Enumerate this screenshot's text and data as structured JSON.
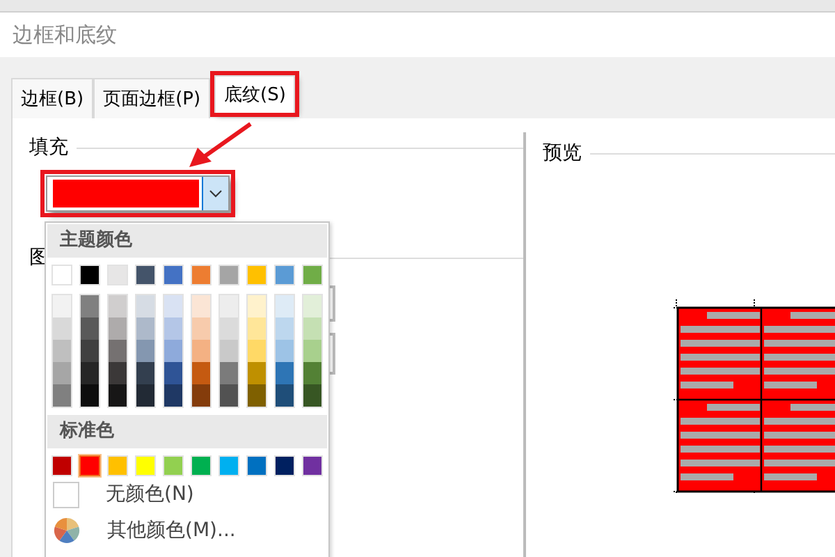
{
  "window": {
    "title": "边框和底纹"
  },
  "tabs": [
    {
      "label": "边框(B)",
      "selected": false
    },
    {
      "label": "页面边框(P)",
      "selected": false
    },
    {
      "label": "底纹(S)",
      "selected": true
    }
  ],
  "fill": {
    "label": "填充"
  },
  "pattern": {
    "label": "图"
  },
  "preview": {
    "label": "预览"
  },
  "color_menu": {
    "theme_heading": "主题颜色",
    "theme_colors": [
      {
        "color": "#ffffff",
        "selected": false,
        "shades": [
          {
            "color": "#f2f2f2",
            "selected": false
          },
          {
            "color": "#d9d9d9",
            "selected": false
          },
          {
            "color": "#bfbfbf",
            "selected": false
          },
          {
            "color": "#a6a6a6",
            "selected": false
          },
          {
            "color": "#808080",
            "selected": false
          }
        ]
      },
      {
        "color": "#000000",
        "selected": false,
        "shades": [
          {
            "color": "#808080",
            "selected": false
          },
          {
            "color": "#595959",
            "selected": false
          },
          {
            "color": "#404040",
            "selected": false
          },
          {
            "color": "#262626",
            "selected": false
          },
          {
            "color": "#0d0d0d",
            "selected": false
          }
        ]
      },
      {
        "color": "#e7e6e6",
        "selected": false,
        "shades": [
          {
            "color": "#d0cece",
            "selected": false
          },
          {
            "color": "#aeabab",
            "selected": false
          },
          {
            "color": "#757171",
            "selected": false
          },
          {
            "color": "#3b3838",
            "selected": false
          },
          {
            "color": "#171616",
            "selected": false
          }
        ]
      },
      {
        "color": "#44546a",
        "selected": false,
        "shades": [
          {
            "color": "#d6dce4",
            "selected": false
          },
          {
            "color": "#adb9ca",
            "selected": false
          },
          {
            "color": "#8497b0",
            "selected": false
          },
          {
            "color": "#333f4f",
            "selected": false
          },
          {
            "color": "#222a35",
            "selected": false
          }
        ]
      },
      {
        "color": "#4472c4",
        "selected": false,
        "shades": [
          {
            "color": "#d9e2f3",
            "selected": false
          },
          {
            "color": "#b4c6e7",
            "selected": false
          },
          {
            "color": "#8eaadb",
            "selected": false
          },
          {
            "color": "#2f5496",
            "selected": false
          },
          {
            "color": "#1f3864",
            "selected": false
          }
        ]
      },
      {
        "color": "#ed7d31",
        "selected": false,
        "shades": [
          {
            "color": "#fbe5d5",
            "selected": false
          },
          {
            "color": "#f7cbac",
            "selected": false
          },
          {
            "color": "#f4b183",
            "selected": false
          },
          {
            "color": "#c55a11",
            "selected": false
          },
          {
            "color": "#843c0b",
            "selected": false
          }
        ]
      },
      {
        "color": "#a5a5a5",
        "selected": false,
        "shades": [
          {
            "color": "#ededed",
            "selected": false
          },
          {
            "color": "#dbdbdb",
            "selected": false
          },
          {
            "color": "#c9c9c9",
            "selected": false
          },
          {
            "color": "#7b7b7b",
            "selected": false
          },
          {
            "color": "#525252",
            "selected": false
          }
        ]
      },
      {
        "color": "#ffc000",
        "selected": false,
        "shades": [
          {
            "color": "#fff2cc",
            "selected": false
          },
          {
            "color": "#ffe699",
            "selected": false
          },
          {
            "color": "#ffd966",
            "selected": false
          },
          {
            "color": "#bf9000",
            "selected": false
          },
          {
            "color": "#7f6000",
            "selected": false
          }
        ]
      },
      {
        "color": "#5b9bd5",
        "selected": false,
        "shades": [
          {
            "color": "#deebf6",
            "selected": false
          },
          {
            "color": "#bdd7ee",
            "selected": false
          },
          {
            "color": "#9dc3e6",
            "selected": false
          },
          {
            "color": "#2e75b5",
            "selected": false
          },
          {
            "color": "#1f4e79",
            "selected": false
          }
        ]
      },
      {
        "color": "#70ad47",
        "selected": false,
        "shades": [
          {
            "color": "#e2efd9",
            "selected": false
          },
          {
            "color": "#c5e0b3",
            "selected": false
          },
          {
            "color": "#a8d08d",
            "selected": false
          },
          {
            "color": "#538135",
            "selected": false
          },
          {
            "color": "#375623",
            "selected": false
          }
        ]
      }
    ],
    "standard_heading": "标准色",
    "standard_colors": [
      {
        "color": "#c00000",
        "selected": false
      },
      {
        "color": "#ff0000",
        "selected": true
      },
      {
        "color": "#ffc000",
        "selected": false
      },
      {
        "color": "#ffff00",
        "selected": false
      },
      {
        "color": "#92d050",
        "selected": false
      },
      {
        "color": "#00b050",
        "selected": false
      },
      {
        "color": "#00b0f0",
        "selected": false
      },
      {
        "color": "#0070c0",
        "selected": false
      },
      {
        "color": "#002060",
        "selected": false
      },
      {
        "color": "#7030a0",
        "selected": false
      }
    ],
    "no_color": "无颜色(N)",
    "more_colors": "其他颜色(M)..."
  }
}
